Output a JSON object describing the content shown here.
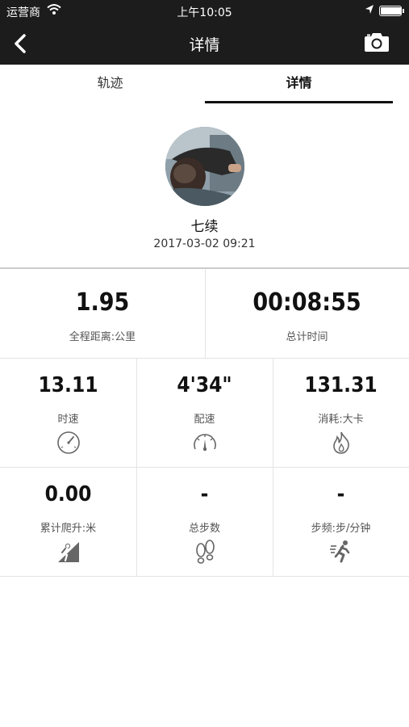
{
  "status_bar": {
    "carrier": "运营商",
    "time": "上午10:05",
    "battery_level": 0.95
  },
  "nav": {
    "title": "详情"
  },
  "tabs": [
    {
      "label": "轨迹",
      "active": false
    },
    {
      "label": "详情",
      "active": true
    }
  ],
  "profile": {
    "name": "七续",
    "datetime": "2017-03-02 09:21"
  },
  "summary": [
    {
      "value": "1.95",
      "label": "全程距离:公里"
    },
    {
      "value": "00:08:55",
      "label": "总计时间"
    }
  ],
  "metrics": [
    {
      "value": "13.11",
      "label": "时速",
      "icon": "speedometer-icon"
    },
    {
      "value": "4'34\"",
      "label": "配速",
      "icon": "pace-gauge-icon"
    },
    {
      "value": "131.31",
      "label": "消耗:大卡",
      "icon": "flame-icon"
    },
    {
      "value": "0.00",
      "label": "累计爬升:米",
      "icon": "climb-icon"
    },
    {
      "value": "-",
      "label": "总步数",
      "icon": "footprints-icon"
    },
    {
      "value": "-",
      "label": "步频:步/分钟",
      "icon": "runner-icon"
    }
  ]
}
